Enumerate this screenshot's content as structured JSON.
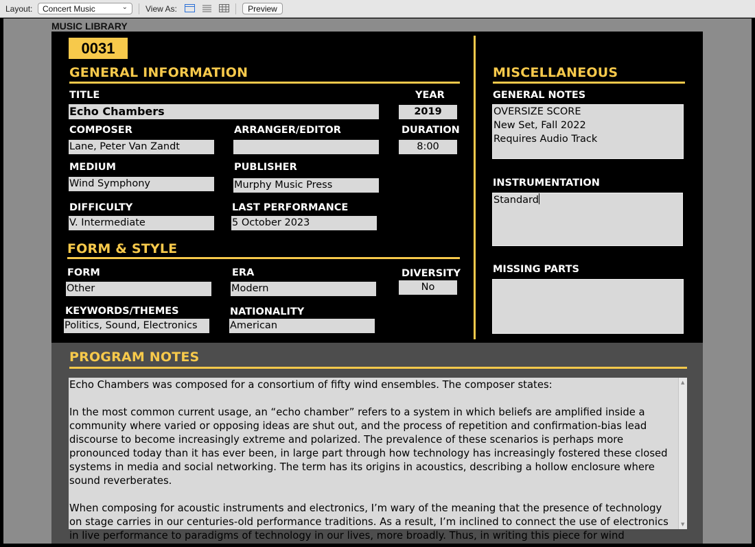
{
  "toolbar": {
    "layout_label": "Layout:",
    "layout_value": "Concert Music",
    "view_as_label": "View As:",
    "view_modes": [
      "form-view-icon",
      "list-view-icon",
      "table-view-icon"
    ],
    "preview_label": "Preview"
  },
  "header": {
    "title": "MUSIC LIBRARY"
  },
  "record": {
    "id": "0031"
  },
  "general": {
    "section_title": "GENERAL INFORMATION",
    "title_label": "TITLE",
    "title_value": "Echo Chambers",
    "year_label": "YEAR",
    "year_value": "2019",
    "composer_label": "COMPOSER",
    "composer_value": "Lane, Peter Van Zandt",
    "arranger_label": "ARRANGER/EDITOR",
    "arranger_value": "",
    "duration_label": "DURATION",
    "duration_value": "8:00",
    "medium_label": "MEDIUM",
    "medium_value": "Wind Symphony",
    "publisher_label": "PUBLISHER",
    "publisher_value": "Murphy Music Press",
    "difficulty_label": "DIFFICULTY",
    "difficulty_value": "V. Intermediate",
    "last_performance_label": "LAST PERFORMANCE",
    "last_performance_value": "5 October 2023"
  },
  "form_style": {
    "section_title": "FORM & STYLE",
    "form_label": "FORM",
    "form_value": "Other",
    "era_label": "ERA",
    "era_value": "Modern",
    "diversity_label": "DIVERSITY",
    "diversity_value": "No",
    "keywords_label": "KEYWORDS/THEMES",
    "keywords_value": "Politics, Sound, Electronics",
    "nationality_label": "NATIONALITY",
    "nationality_value": "American"
  },
  "misc": {
    "section_title": "MISCELLANEOUS",
    "notes_label": "GENERAL NOTES",
    "notes_value": "OVERSIZE SCORE\nNew Set, Fall 2022\nRequires Audio Track",
    "instrumentation_label": "INSTRUMENTATION",
    "instrumentation_value": "Standard",
    "missing_parts_label": "MISSING PARTS",
    "missing_parts_value": ""
  },
  "program_notes": {
    "section_title": "PROGRAM NOTES",
    "text": "Echo Chambers was composed for a consortium of fifty wind ensembles. The composer states:\n\nIn the most common current usage, an “echo chamber” refers to a system in which beliefs are amplified inside a community where varied or opposing ideas are shut out, and the process of repetition and confirmation-bias lead discourse to become increasingly extreme and polarized. The prevalence of these scenarios is perhaps more pronounced today than it has ever been, in large part through how technology has increasingly fostered these closed systems in media and social networking. The term has its origins in acoustics, describing a hollow enclosure where sound reverberates.\n\nWhen composing for acoustic instruments and electronics, I’m wary of the meaning that the presence of technology on stage carries in our centuries-old performance traditions. As a result, I’m inclined to connect the use of electronics in live performance to paradigms of technology in our lives, more broadly. Thus, in writing this piece for wind ensemble and electronics, I wanted to find"
  },
  "colors": {
    "accent": "#f7c94b",
    "background": "#000000",
    "field": "#d9d9d9",
    "chrome": "#8c8c8c"
  }
}
